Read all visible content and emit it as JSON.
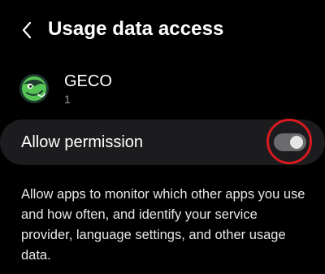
{
  "header": {
    "back_icon": "chevron-left-icon",
    "title": "Usage data access"
  },
  "app": {
    "name": "GECO",
    "subtitle": "1",
    "icon": "geco-gecko-icon"
  },
  "permission": {
    "label": "Allow permission",
    "toggle_on": false
  },
  "description": "Allow apps to monitor which other apps you use and how often, and identify your service provider, language settings, and other usage data.",
  "colors": {
    "background": "#000000",
    "card": "#1c1c1e",
    "highlight_ring": "#d71920",
    "icon_green": "#55c455"
  }
}
